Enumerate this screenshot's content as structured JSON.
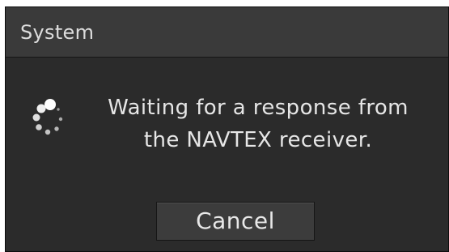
{
  "dialog": {
    "title": "System",
    "message_line1": "Waiting for a response from",
    "message_line2": "the NAVTEX receiver.",
    "cancel_label": "Cancel",
    "spinner_icon": "loading-spinner-icon"
  },
  "colors": {
    "panel": "#2b2b2b",
    "titlebar": "#3a3a3a",
    "text": "#e6e6e6",
    "button": "#3c3c3c"
  }
}
